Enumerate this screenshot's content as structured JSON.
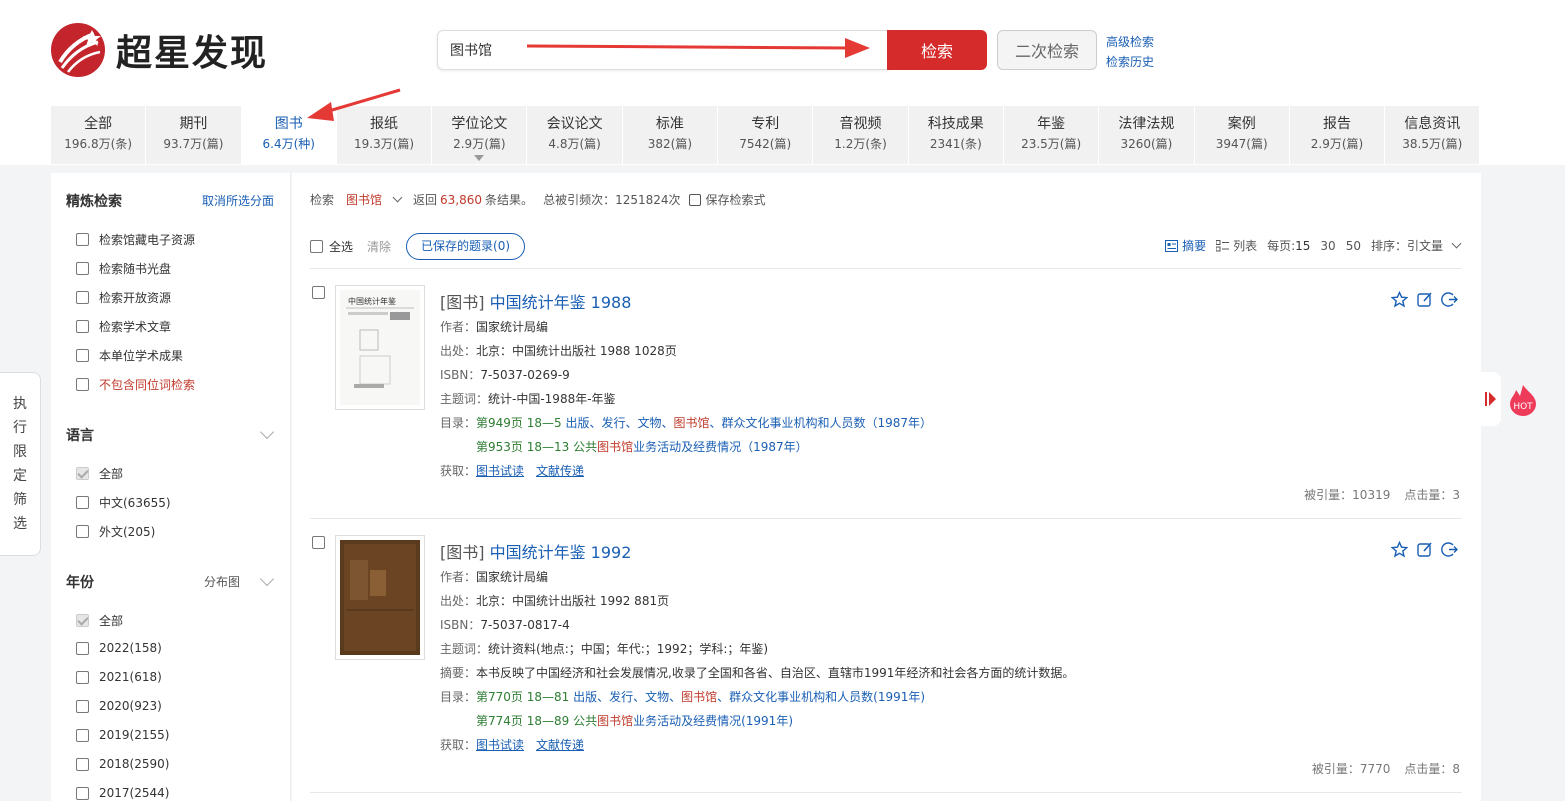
{
  "app": {
    "logo_text": "超星发现"
  },
  "search": {
    "value": "图书馆",
    "button": "检索",
    "second_button": "二次检索",
    "advanced": "高级检索",
    "history": "检索历史"
  },
  "tabs": [
    {
      "label": "全部",
      "count": "196.8万(条)"
    },
    {
      "label": "期刊",
      "count": "93.7万(篇)"
    },
    {
      "label": "图书",
      "count": "6.4万(种)",
      "active": true
    },
    {
      "label": "报纸",
      "count": "19.3万(篇)"
    },
    {
      "label": "学位论文",
      "count": "2.9万(篇)"
    },
    {
      "label": "会议论文",
      "count": "4.8万(篇)"
    },
    {
      "label": "标准",
      "count": "382(篇)"
    },
    {
      "label": "专利",
      "count": "7542(篇)"
    },
    {
      "label": "音视频",
      "count": "1.2万(条)"
    },
    {
      "label": "科技成果",
      "count": "2341(条)"
    },
    {
      "label": "年鉴",
      "count": "23.5万(篇)"
    },
    {
      "label": "法律法规",
      "count": "3260(篇)"
    },
    {
      "label": "案例",
      "count": "3947(篇)"
    },
    {
      "label": "报告",
      "count": "2.9万(篇)"
    },
    {
      "label": "信息资讯",
      "count": "38.5万(篇)"
    }
  ],
  "sidebar": {
    "title": "精炼检索",
    "clear": "取消所选分面",
    "filters": [
      "检索馆藏电子资源",
      "检索随书光盘",
      "检索开放资源",
      "检索学术文章",
      "本单位学术成果",
      "不包含同位词检索"
    ],
    "language": {
      "title": "语言",
      "items": [
        "全部",
        "中文(63655)",
        "外文(205)"
      ]
    },
    "year": {
      "title": "年份",
      "dist": "分布图",
      "items": [
        "全部",
        "2022(158)",
        "2021(618)",
        "2020(923)",
        "2019(2155)",
        "2018(2590)",
        "2017(2544)"
      ]
    }
  },
  "side_tab": [
    "执",
    "行",
    "限",
    "定",
    "筛",
    "选"
  ],
  "query_bar": {
    "label": "检索",
    "keyword": "图书馆",
    "returned": "返回",
    "count": "63,860",
    "results": "条结果。",
    "cited": "总被引频次：1251824次",
    "save": "保存检索式"
  },
  "toolbar": {
    "select_all": "全选",
    "clear": "清除",
    "saved": "已保存的题录(0)",
    "abstract": "摘要",
    "list": "列表",
    "per_page": "每页:",
    "p15": "15",
    "p30": "30",
    "p50": "50",
    "sort": "排序：引文量"
  },
  "results": [
    {
      "type": "[图书]",
      "title": "中国统计年鉴 1988",
      "author_lbl": "作者：",
      "author": "国家统计局编",
      "source_lbl": "出处：",
      "source": "北京：中国统计出版社 1988 1028页",
      "isbn_lbl": "ISBN：",
      "isbn": "7-5037-0269-9",
      "subject_lbl": "主题词：",
      "subject": "统计-中国-1988年-年鉴",
      "toc_lbl": "目录：",
      "toc1a": "第949页 18—5",
      "toc1b": "出版、发行、文物、",
      "toc1c": "图书馆",
      "toc1d": "、群众文化事业机构和人员数（1987年）",
      "toc2a": "第953页 18—13 公共",
      "toc2b": "图书馆",
      "toc2c": "业务活动及经费情况（1987年）",
      "get_lbl": "获取：",
      "get1": "图书试读",
      "get2": "文献传递",
      "cited": "被引量：10319",
      "clicks": "点击量：3"
    },
    {
      "type": "[图书]",
      "title": "中国统计年鉴 1992",
      "author_lbl": "作者：",
      "author": "国家统计局编",
      "source_lbl": "出处：",
      "source": "北京：中国统计出版社 1992 881页",
      "isbn_lbl": "ISBN：",
      "isbn": "7-5037-0817-4",
      "subject_lbl": "主题词：",
      "subject": "统计资料(地点:；中国；年代:；1992；学科:；年鉴)",
      "abstract_lbl": "摘要：",
      "abstract": "本书反映了中国经济和社会发展情况,收录了全国和各省、自治区、直辖市1991年经济和社会各方面的统计数据。",
      "toc_lbl": "目录：",
      "toc1a": "第770页 18—81",
      "toc1b": "出版、发行、文物、",
      "toc1c": "图书馆",
      "toc1d": "、群众文化事业机构和人员数(1991年)",
      "toc2a": "第774页 18—89 公共",
      "toc2b": "图书馆",
      "toc2c": "业务活动及经费情况(1991年)",
      "get_lbl": "获取：",
      "get1": "图书试读",
      "get2": "文献传递",
      "cited": "被引量：7770",
      "clicks": "点击量：8"
    }
  ],
  "hot_label": "HOT",
  "colors": {
    "brand_red": "#d52b2b",
    "link_blue": "#1a5fb4"
  }
}
